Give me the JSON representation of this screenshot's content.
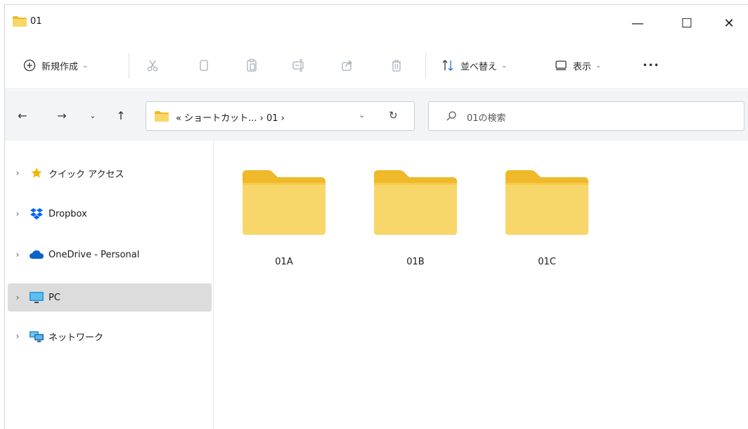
{
  "window": {
    "title": "01",
    "min_glyph": "—",
    "max_glyph": "☐",
    "close_glyph": "✕"
  },
  "toolbar": {
    "new_label": "新規作成",
    "new_chev": "⌄",
    "sort_label": "並べ替え",
    "sort_chev": "⌄",
    "view_label": "表示",
    "view_chev": "⌄",
    "more_label": "•••"
  },
  "nav": {
    "back": "←",
    "forward": "→",
    "recent": "⌄",
    "up": "↑"
  },
  "address": {
    "path": "« ショートカット... › 01 ›",
    "dropdown": "⌄",
    "refresh": "↻"
  },
  "search": {
    "placeholder": "01の検索"
  },
  "sidebar": {
    "items": [
      {
        "label": "クイック アクセス",
        "icon": "star-icon"
      },
      {
        "label": "Dropbox",
        "icon": "dropbox-icon"
      },
      {
        "label": "OneDrive - Personal",
        "icon": "cloud-icon"
      },
      {
        "label": "PC",
        "icon": "monitor-icon",
        "selected": true
      },
      {
        "label": "ネットワーク",
        "icon": "network-icon"
      }
    ],
    "chevron": "›"
  },
  "content": {
    "folders": [
      {
        "name": "01A"
      },
      {
        "name": "01B"
      },
      {
        "name": "01C"
      }
    ]
  },
  "colors": {
    "folder_front": "#f8d76a",
    "folder_back": "#f0b92a",
    "selection": "#dcdcdc"
  }
}
